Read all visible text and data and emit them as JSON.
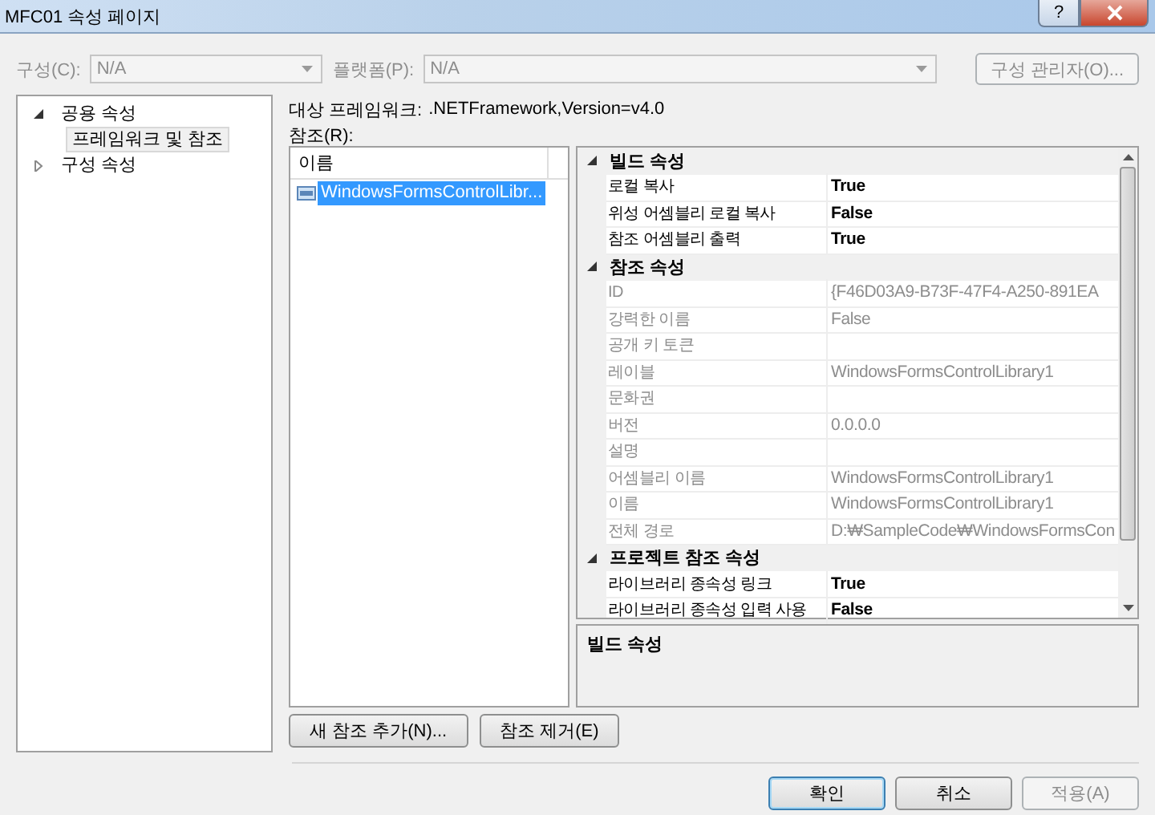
{
  "window": {
    "title": "MFC01 속성 페이지",
    "help": "?"
  },
  "config_bar": {
    "disabled": true,
    "configuration": {
      "label": "구성(C):",
      "value": "N/A"
    },
    "platform": {
      "label": "플랫폼(P):",
      "value": "N/A"
    },
    "manager_button": "구성 관리자(O)..."
  },
  "tree": [
    {
      "label": "공용 속성",
      "expanded": true,
      "selected": false,
      "children": [
        {
          "label": "프레임워크 및 참조",
          "selected": true
        }
      ]
    },
    {
      "label": "구성 속성",
      "expanded": false,
      "selected": false
    }
  ],
  "target_framework": {
    "label": "대상 프레임워크:",
    "value": ".NETFramework,Version=v4.0"
  },
  "references_label": "참조(R):",
  "references": {
    "column": "이름",
    "items": [
      {
        "name": "WindowsFormsControlLibr...",
        "selected": true
      }
    ]
  },
  "property_grid": [
    {
      "name": "빌드 속성",
      "expanded": true,
      "properties": [
        {
          "name": "로컬 복사",
          "value": "True",
          "disabled": false
        },
        {
          "name": "위성 어셈블리 로컬 복사",
          "value": "False",
          "disabled": false
        },
        {
          "name": "참조 어셈블리 출력",
          "value": "True",
          "disabled": false
        }
      ]
    },
    {
      "name": "참조 속성",
      "expanded": true,
      "properties": [
        {
          "name": "ID",
          "value": "{F46D03A9-B73F-47F4-A250-891EA",
          "disabled": true
        },
        {
          "name": "강력한 이름",
          "value": "False",
          "disabled": true
        },
        {
          "name": "공개 키 토큰",
          "disabled": true
        },
        {
          "name": "레이블",
          "value": "WindowsFormsControlLibrary1",
          "disabled": true
        },
        {
          "name": "문화권",
          "disabled": true
        },
        {
          "name": "버전",
          "value": "0.0.0.0",
          "disabled": true
        },
        {
          "name": "설명",
          "disabled": true
        },
        {
          "name": "어셈블리 이름",
          "value": "WindowsFormsControlLibrary1",
          "disabled": true
        },
        {
          "name": "이름",
          "value": "WindowsFormsControlLibrary1",
          "disabled": true
        },
        {
          "name": "전체 경로",
          "value": "D:₩SampleCode₩WindowsFormsCon",
          "disabled": true
        }
      ]
    },
    {
      "name": "프로젝트 참조 속성",
      "expanded": true,
      "properties": [
        {
          "name": "라이브러리 종속성 링크",
          "value": "True",
          "disabled": false
        },
        {
          "name": "라이브러리 종속성 입력 사용",
          "value": "False",
          "disabled": false
        }
      ]
    }
  ],
  "description": {
    "title": "빌드 속성"
  },
  "reference_buttons": [
    "새 참조 추가(N)...",
    "참조 제거(E)"
  ],
  "dialog_buttons": [
    {
      "label": "확인",
      "disabled": false,
      "default": true
    },
    {
      "label": "취소",
      "disabled": false,
      "default": false
    },
    {
      "label": "적용(A)",
      "disabled": true,
      "default": false
    }
  ]
}
